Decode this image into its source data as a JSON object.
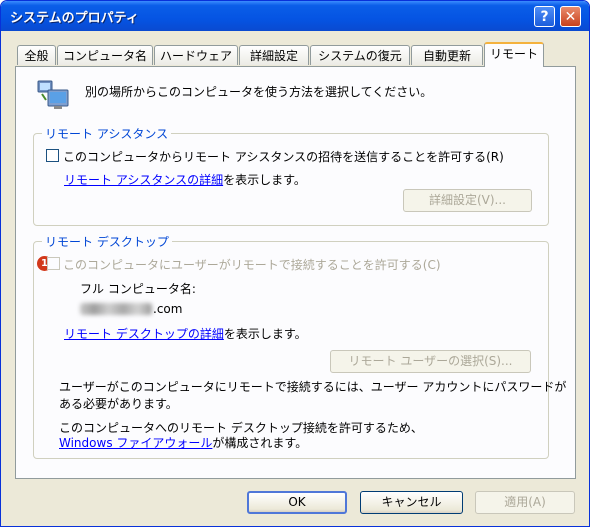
{
  "window": {
    "title": "システムのプロパティ",
    "help_label": "?",
    "close_label": "✕"
  },
  "tabs": [
    {
      "label": "全般"
    },
    {
      "label": "コンピュータ名"
    },
    {
      "label": "ハードウェア"
    },
    {
      "label": "詳細設定"
    },
    {
      "label": "システムの復元"
    },
    {
      "label": "自動更新"
    },
    {
      "label": "リモート",
      "active": true
    }
  ],
  "intro": {
    "text": "別の場所からこのコンピュータを使う方法を選択してください。",
    "icon": "remote-computers-icon"
  },
  "assistance": {
    "group_label": "リモート アシスタンス",
    "checkbox_label": "このコンピュータからリモート アシスタンスの招待を送信することを許可する(R)",
    "checked": false,
    "details_link": "リモート アシスタンスの詳細",
    "details_suffix": "を表示します。",
    "advanced_button": "詳細設定(V)..."
  },
  "desktop": {
    "group_label": "リモート デスクトップ",
    "checkbox_label": "このコンピュータにユーザーがリモートで接続することを許可する(C)",
    "checked": false,
    "badge": "1",
    "full_name_label": "フル コンピュータ名:",
    "full_name_value": ".com",
    "details_link": "リモート デスクトップの詳細",
    "details_suffix": "を表示します。",
    "select_users_button": "リモート ユーザーの選択(S)...",
    "note1_line1": "ユーザーがこのコンピュータにリモートで接続するには、ユーザー アカウントにパスワードが",
    "note1_line2": "ある必要があります。",
    "note2_line1": "このコンピュータへのリモート デスクトップ接続を許可するため、",
    "note2_link": "Windows ファイアウォール",
    "note2_suffix": "が構成されます。"
  },
  "footer": {
    "ok": "OK",
    "cancel": "キャンセル",
    "apply": "適用(A)"
  }
}
